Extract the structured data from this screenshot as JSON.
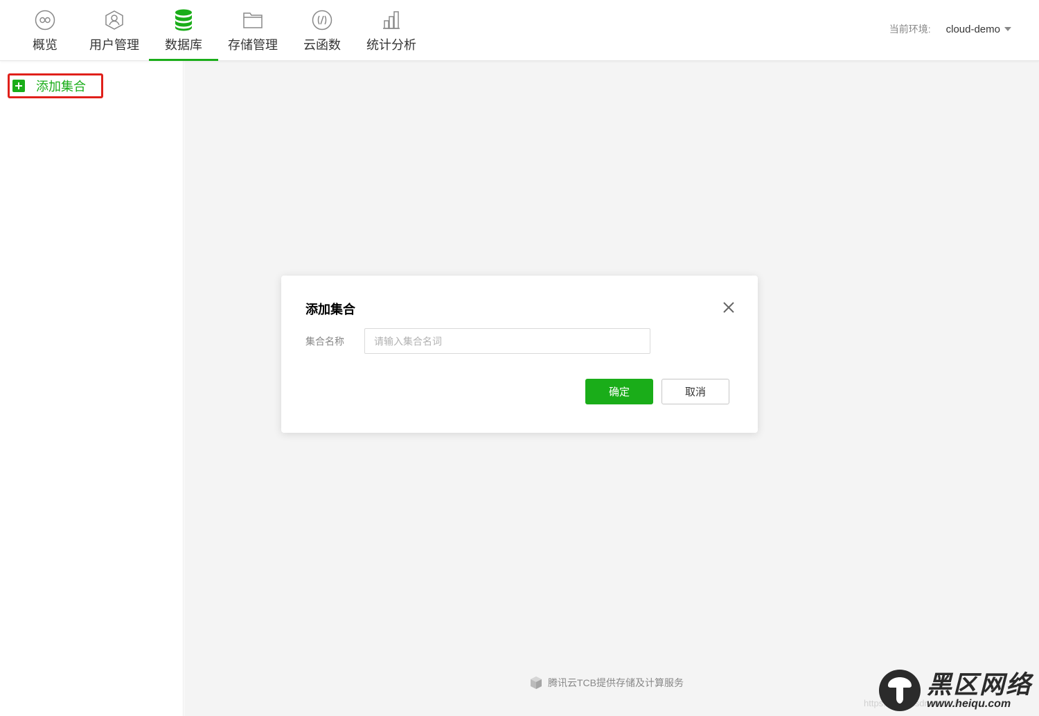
{
  "nav": {
    "items": [
      {
        "label": "概览",
        "icon": "overview-icon"
      },
      {
        "label": "用户管理",
        "icon": "user-icon"
      },
      {
        "label": "数据库",
        "icon": "database-icon",
        "active": true
      },
      {
        "label": "存储管理",
        "icon": "folder-icon"
      },
      {
        "label": "云函数",
        "icon": "function-icon"
      },
      {
        "label": "统计分析",
        "icon": "chart-icon"
      }
    ]
  },
  "env": {
    "label": "当前环境:",
    "value": "cloud-demo"
  },
  "sidebar": {
    "add_label": "添加集合"
  },
  "modal": {
    "title": "添加集合",
    "field_label": "集合名称",
    "placeholder": "请输入集合名词",
    "value": "",
    "ok_label": "确定",
    "cancel_label": "取消"
  },
  "footer": {
    "text": "腾讯云TCB提供存储及计算服务"
  },
  "watermark": {
    "main": "黑区网络",
    "sub": "www.heiqu.com",
    "url": "https://blog.csdn.net/...6"
  },
  "colors": {
    "accent": "#1aad19",
    "highlight_border": "#e0201a",
    "background": "#f4f4f4"
  }
}
